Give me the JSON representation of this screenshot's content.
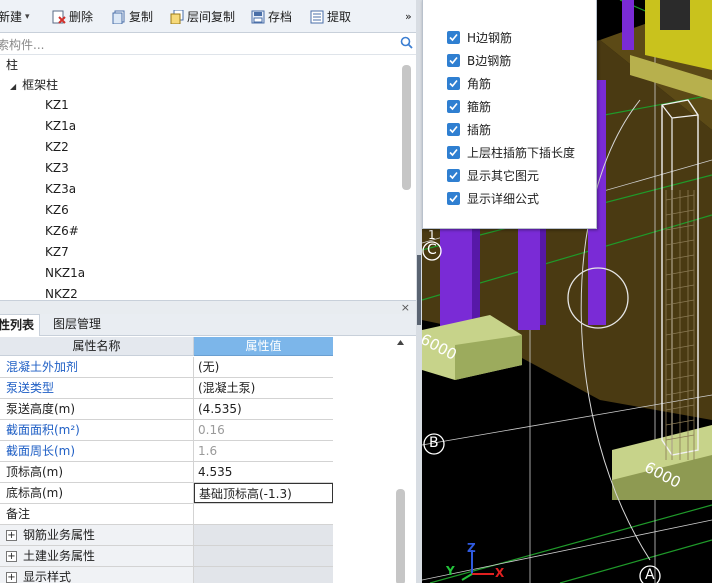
{
  "toolbar": {
    "new_label": "新建",
    "delete_label": "删除",
    "copy_label": "复制",
    "floor_copy_label": "层间复制",
    "save_label": "存档",
    "extract_label": "提取",
    "more_label": "»"
  },
  "search": {
    "placeholder": "索构件..."
  },
  "tree": {
    "root": "柱",
    "group": "框架柱",
    "items": [
      "KZ1",
      "KZ1a",
      "KZ2",
      "KZ3",
      "KZ3a",
      "KZ6",
      "KZ6#",
      "KZ7",
      "NKZ1a",
      "NKZ2"
    ]
  },
  "panel": {
    "close": "×"
  },
  "tabs": {
    "properties": "性列表",
    "layers": "图层管理"
  },
  "grid": {
    "header_name": "属性名称",
    "header_value": "属性值",
    "rows": [
      {
        "name": "混凝土外加剂",
        "value": "(无)"
      },
      {
        "name": "泵送类型",
        "value": "(混凝土泵)"
      },
      {
        "name": "泵送高度(m)",
        "value": "(4.535)"
      },
      {
        "name": "截面面积(m²)",
        "value": "0.16"
      },
      {
        "name": "截面周长(m)",
        "value": "1.6"
      },
      {
        "name": "顶标高(m)",
        "value": "4.535"
      },
      {
        "name": "底标高(m)",
        "value": "基础顶标高(-1.3)"
      },
      {
        "name": "备注",
        "value": ""
      },
      {
        "name": "钢筋业务属性",
        "value": ""
      },
      {
        "name": "土建业务属性",
        "value": ""
      },
      {
        "name": "显示样式",
        "value": ""
      }
    ]
  },
  "options": [
    {
      "label": "H边钢筋",
      "checked": true
    },
    {
      "label": "B边钢筋",
      "checked": true
    },
    {
      "label": "角筋",
      "checked": true
    },
    {
      "label": "箍筋",
      "checked": true
    },
    {
      "label": "插筋",
      "checked": true
    },
    {
      "label": "上层柱插筋下插长度",
      "checked": true
    },
    {
      "label": "显示其它图元",
      "checked": true
    },
    {
      "label": "显示详细公式",
      "checked": true
    }
  ],
  "viewport": {
    "axis_labels": [
      "C",
      "B",
      "A"
    ],
    "dimension_labels": [
      "6000",
      "6000"
    ],
    "gizmo": {
      "x": "X",
      "y": "Y",
      "z": "Z"
    },
    "partial_label": "1"
  },
  "colors": {
    "accent": "#2f7fd1",
    "header_value_bg": "#7cb6ea",
    "link": "#1f5fc5"
  }
}
